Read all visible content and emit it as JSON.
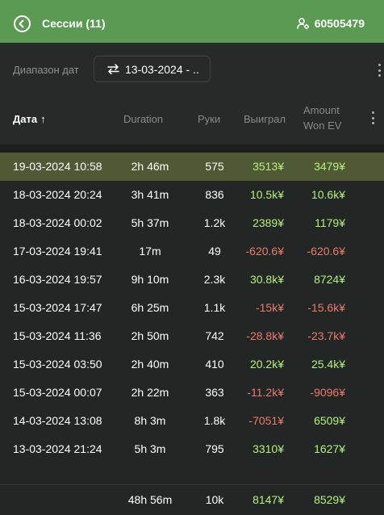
{
  "header": {
    "title": "Сессии (11)",
    "user_id": "60505479"
  },
  "filter": {
    "label": "Диапазон дат",
    "date_value": "13-03-2024 - .."
  },
  "columns": {
    "date": "Дата",
    "duration": "Duration",
    "hands": "Руки",
    "won": "Выиграл",
    "amount_won_ev_line1": "Amount",
    "amount_won_ev_line2": "Won EV",
    "sort_indicator": "↑"
  },
  "rows": [
    {
      "date": "19-03-2024 10:58",
      "duration": "2h 46m",
      "hands": "575",
      "won": "3513¥",
      "won_ev": "3479¥",
      "highlighted": true
    },
    {
      "date": "18-03-2024 20:24",
      "duration": "3h 41m",
      "hands": "836",
      "won": "10.5k¥",
      "won_ev": "10.6k¥"
    },
    {
      "date": "18-03-2024 00:02",
      "duration": "5h 37m",
      "hands": "1.2k",
      "won": "2389¥",
      "won_ev": "1179¥"
    },
    {
      "date": "17-03-2024 19:41",
      "duration": "17m",
      "hands": "49",
      "won": "-620.6¥",
      "won_ev": "-620.6¥"
    },
    {
      "date": "16-03-2024 19:57",
      "duration": "9h 10m",
      "hands": "2.3k",
      "won": "30.8k¥",
      "won_ev": "8724¥"
    },
    {
      "date": "15-03-2024 17:47",
      "duration": "6h 25m",
      "hands": "1.1k",
      "won": "-15k¥",
      "won_ev": "-15.6k¥"
    },
    {
      "date": "15-03-2024 11:36",
      "duration": "2h 50m",
      "hands": "742",
      "won": "-28.8k¥",
      "won_ev": "-23.7k¥"
    },
    {
      "date": "15-03-2024 03:50",
      "duration": "2h 40m",
      "hands": "410",
      "won": "20.2k¥",
      "won_ev": "25.4k¥"
    },
    {
      "date": "15-03-2024 00:07",
      "duration": "2h 22m",
      "hands": "363",
      "won": "-11.2k¥",
      "won_ev": "-9096¥"
    },
    {
      "date": "14-03-2024 13:08",
      "duration": "8h 3m",
      "hands": "1.8k",
      "won": "-7051¥",
      "won_ev": "6509¥"
    },
    {
      "date": "13-03-2024 21:24",
      "duration": "5h 3m",
      "hands": "795",
      "won": "3310¥",
      "won_ev": "1627¥"
    }
  ],
  "totals": {
    "duration": "48h 56m",
    "hands": "10k",
    "won": "8147¥",
    "won_ev": "8529¥"
  },
  "colors": {
    "header_bg": "#5b9a52",
    "positive": "#b7f07e",
    "negative": "#ef7a6e",
    "highlight_row": "#4f5a34"
  },
  "icons": {
    "back": "back-arrow-circle-icon",
    "user": "user-settings-icon",
    "swap": "swap-arrows-icon",
    "more": "more-vertical-icon"
  }
}
